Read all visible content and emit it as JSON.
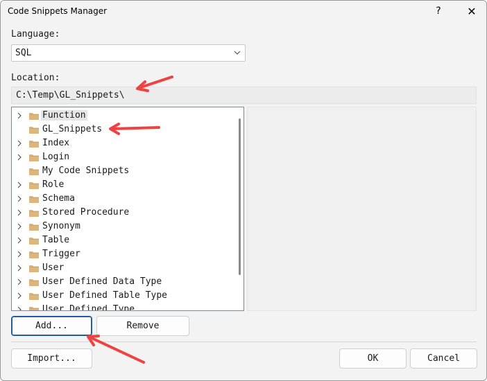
{
  "window": {
    "title": "Code Snippets Manager",
    "help_label": "?",
    "close_label": "✕"
  },
  "language": {
    "label": "Language:",
    "selected": "SQL"
  },
  "location": {
    "label": "Location:",
    "value": "C:\\Temp\\GL_Snippets\\"
  },
  "tree": {
    "items": [
      {
        "label": "Function",
        "expandable": true,
        "selected": true
      },
      {
        "label": "GL_Snippets",
        "expandable": false,
        "selected": false
      },
      {
        "label": "Index",
        "expandable": true,
        "selected": false
      },
      {
        "label": "Login",
        "expandable": true,
        "selected": false
      },
      {
        "label": "My Code Snippets",
        "expandable": false,
        "selected": false
      },
      {
        "label": "Role",
        "expandable": true,
        "selected": false
      },
      {
        "label": "Schema",
        "expandable": true,
        "selected": false
      },
      {
        "label": "Stored Procedure",
        "expandable": true,
        "selected": false
      },
      {
        "label": "Synonym",
        "expandable": true,
        "selected": false
      },
      {
        "label": "Table",
        "expandable": true,
        "selected": false
      },
      {
        "label": "Trigger",
        "expandable": true,
        "selected": false
      },
      {
        "label": "User",
        "expandable": true,
        "selected": false
      },
      {
        "label": "User Defined Data Type",
        "expandable": true,
        "selected": false
      },
      {
        "label": "User Defined Table Type",
        "expandable": true,
        "selected": false
      },
      {
        "label": "User Defined Type",
        "expandable": true,
        "selected": false
      }
    ]
  },
  "buttons": {
    "add": "Add...",
    "remove": "Remove",
    "import": "Import...",
    "ok": "OK",
    "cancel": "Cancel"
  },
  "colors": {
    "folder": "#dcb67a",
    "annotation_arrow": "#ef4242",
    "accent_border": "#1f5f9f"
  }
}
